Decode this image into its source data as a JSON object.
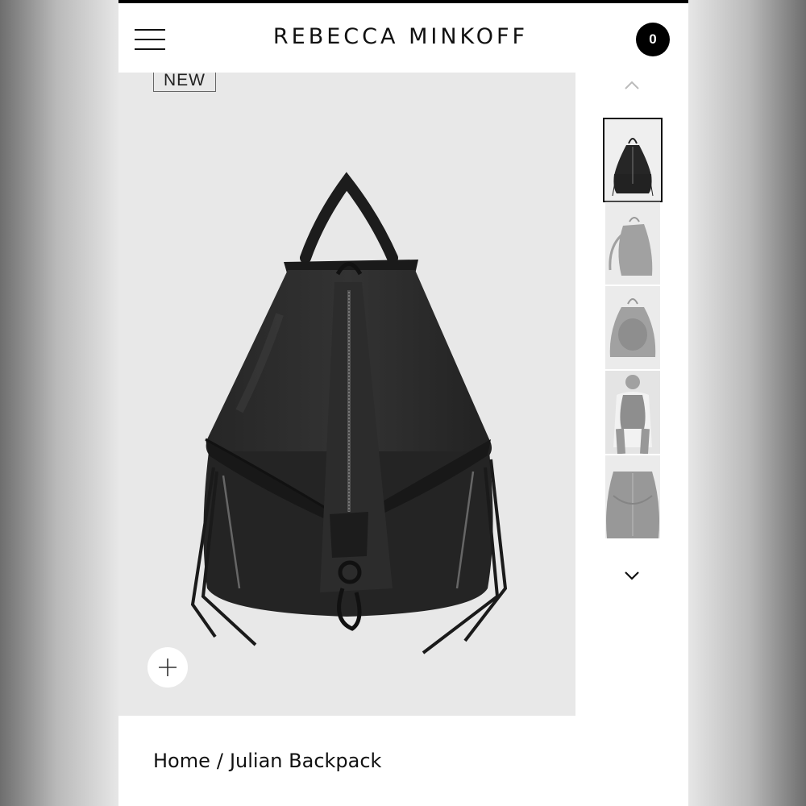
{
  "header": {
    "brand": "REBECCA MINKOFF",
    "cart_count": "0",
    "menu_icon": "hamburger-icon"
  },
  "product": {
    "badge": "NEW",
    "zoom_icon": "plus-icon"
  },
  "gallery": {
    "up_icon": "chevron-up-icon",
    "down_icon": "chevron-down-icon",
    "thumbnails": [
      "backpack-front",
      "backpack-side",
      "backpack-open",
      "backpack-on-model-back",
      "backpack-detail"
    ],
    "selected_index": 0
  },
  "breadcrumb": {
    "home": "Home",
    "separator": "/",
    "current": "Julian Backpack"
  },
  "colors": {
    "accent": "#000000",
    "image_bg": "#e8e8e8",
    "bag": "#1f1f1f"
  }
}
